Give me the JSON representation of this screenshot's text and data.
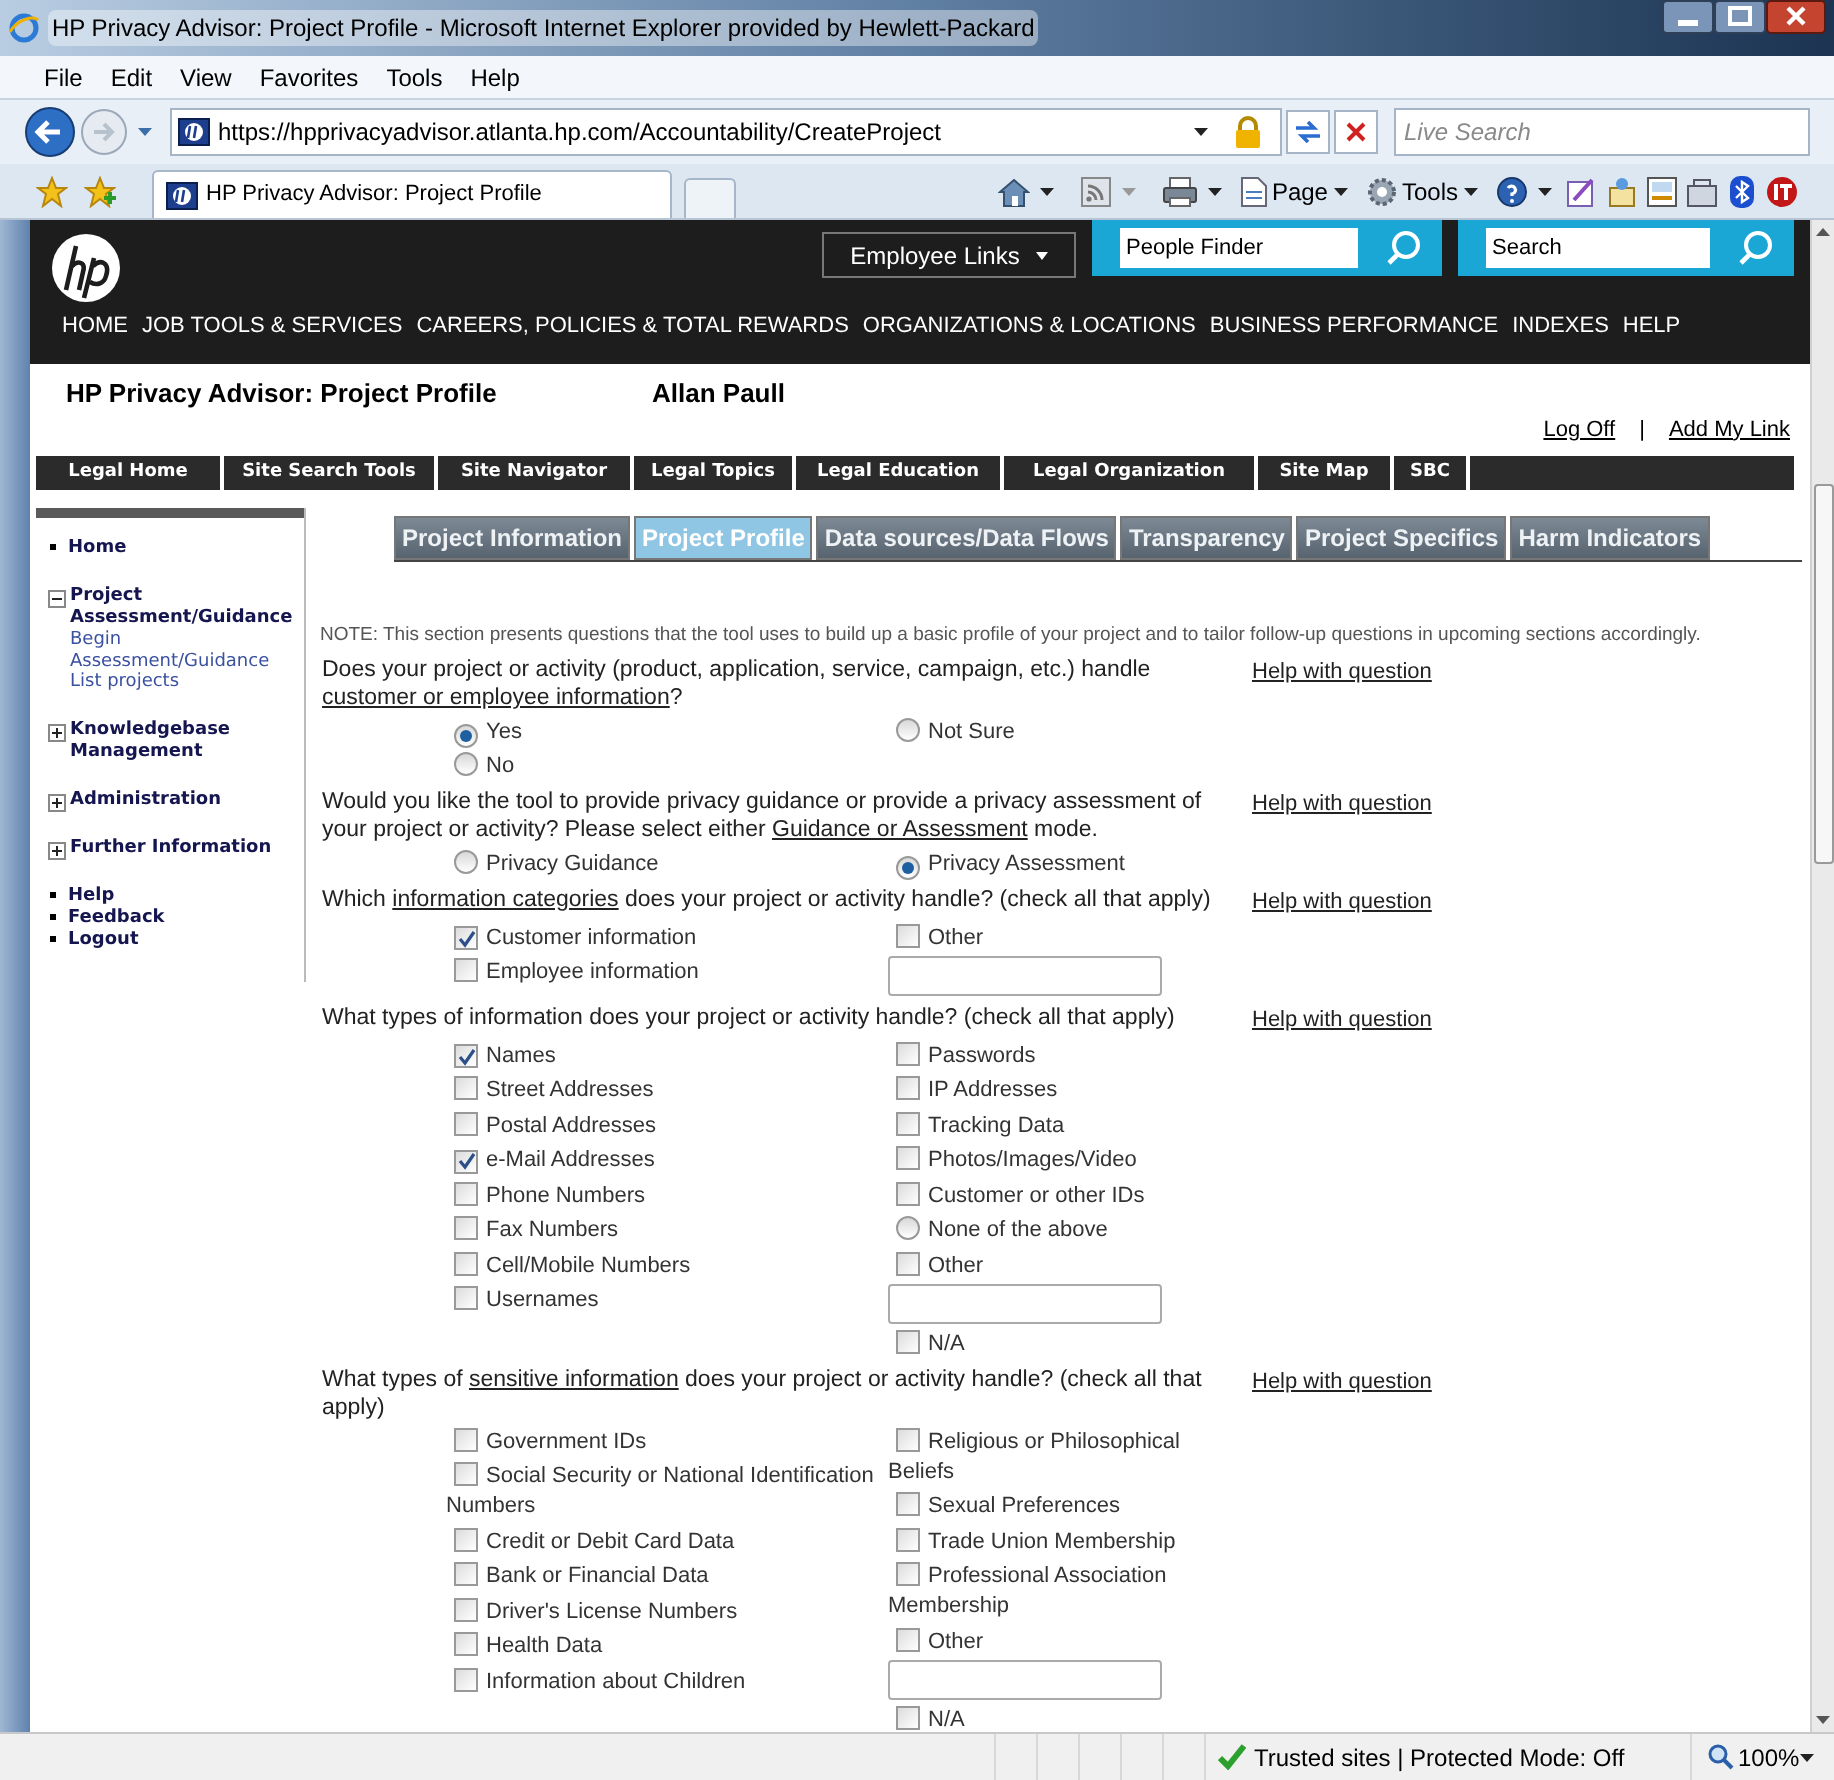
{
  "window": {
    "title": "HP Privacy Advisor: Project Profile - Microsoft Internet Explorer provided by Hewlett-Packard"
  },
  "menu": [
    "File",
    "Edit",
    "View",
    "Favorites",
    "Tools",
    "Help"
  ],
  "address_bar": {
    "url": "https://hpprivacyadvisor.atlanta.hp.com/Accountability/CreateProject",
    "search_placeholder": "Live Search"
  },
  "browser_tab": {
    "title": "HP Privacy Advisor: Project Profile"
  },
  "command_bar": [
    {
      "label": "Page"
    },
    {
      "label": "Tools"
    }
  ],
  "header": {
    "employee_links": "Employee Links",
    "people_finder": "People Finder",
    "search": "Search"
  },
  "top_nav": [
    "HOME",
    "JOB TOOLS & SERVICES",
    "CAREERS, POLICIES & TOTAL REWARDS",
    "ORGANIZATIONS & LOCATIONS",
    "BUSINESS PERFORMANCE",
    "INDEXES",
    "HELP"
  ],
  "page_title": "HP Privacy Advisor: Project Profile",
  "user": "Allan Paull",
  "user_links": [
    {
      "kind": "link",
      "text": "Log Off"
    },
    {
      "kind": "separator",
      "text": "|"
    },
    {
      "kind": "link",
      "text": "Add My Link"
    }
  ],
  "legal_nav": [
    "Legal Home",
    "Site Search Tools",
    "Site Navigator",
    "Legal Topics",
    "Legal Education",
    "Legal Organization",
    "Site Map",
    "SBC"
  ],
  "sidebar": {
    "groups": [
      [
        {
          "kind": "bullet",
          "label": "Home"
        }
      ],
      [
        {
          "kind": "tree",
          "label": "Project Assessment/Guidance",
          "expanded": true,
          "children": [
            {
              "label": "Begin Assessment/Guidance"
            },
            {
              "label": "List projects"
            }
          ]
        }
      ],
      [
        {
          "kind": "tree",
          "label": "Knowledgebase Management",
          "expanded": false
        }
      ],
      [
        {
          "kind": "tree",
          "label": "Administration",
          "expanded": false
        }
      ],
      [
        {
          "kind": "tree",
          "label": "Further Information",
          "expanded": false
        }
      ],
      [
        {
          "kind": "bullet",
          "label": "Help"
        },
        {
          "kind": "bullet",
          "label": "Feedback"
        },
        {
          "kind": "bullet",
          "label": "Logout"
        }
      ]
    ]
  },
  "tabs": [
    {
      "label": "Project Information",
      "selected": false
    },
    {
      "label": "Project Profile",
      "selected": true
    },
    {
      "label": "Data sources/Data Flows",
      "selected": false
    },
    {
      "label": "Transparency",
      "selected": false
    },
    {
      "label": "Project Specifics",
      "selected": false
    },
    {
      "label": "Harm Indicators",
      "selected": false
    }
  ],
  "note": "NOTE: This section presents questions that the tool uses to build up a basic profile of your project and to tailor follow-up questions in upcoming sections accordingly.",
  "questions": [
    {
      "parts": [
        {
          "kind": "plain",
          "text": "Does your project or activity (product, application, service, campaign, etc.) handle "
        },
        {
          "kind": "link",
          "text": "customer or employee information"
        },
        {
          "kind": "plain",
          "text": "?"
        }
      ],
      "help": "Help with question",
      "columns": [
        [
          {
            "kind": "radio",
            "label": "Yes",
            "checked": true
          },
          {
            "kind": "radio",
            "label": "No",
            "checked": false
          }
        ],
        [
          {
            "kind": "radio",
            "label": "Not Sure",
            "checked": false
          }
        ]
      ]
    },
    {
      "parts": [
        {
          "kind": "plain",
          "text": "Would you like the tool to provide privacy guidance or provide a privacy assessment of your project or activity? Please select either "
        },
        {
          "kind": "link",
          "text": "Guidance or Assessment"
        },
        {
          "kind": "plain",
          "text": " mode."
        }
      ],
      "help": "Help with question",
      "columns": [
        [
          {
            "kind": "radio",
            "label": "Privacy Guidance",
            "checked": false
          }
        ],
        [
          {
            "kind": "radio",
            "label": "Privacy Assessment",
            "checked": true
          }
        ]
      ]
    },
    {
      "parts": [
        {
          "kind": "plain",
          "text": "Which "
        },
        {
          "kind": "link",
          "text": "information categories"
        },
        {
          "kind": "plain",
          "text": " does your project or activity handle? (check all that apply)"
        }
      ],
      "help": "Help with question",
      "columns": [
        [
          {
            "kind": "checkbox",
            "label": "Customer information",
            "checked": true
          },
          {
            "kind": "checkbox",
            "label": "Employee information",
            "checked": false
          }
        ],
        [
          {
            "kind": "checkbox",
            "label": "Other",
            "checked": false
          },
          {
            "kind": "field"
          }
        ]
      ]
    },
    {
      "parts": [
        {
          "kind": "plain",
          "text": "What types of information does your project or activity handle? (check all that apply)"
        }
      ],
      "help": "Help with question",
      "columns": [
        [
          {
            "kind": "checkbox",
            "label": "Names",
            "checked": true
          },
          {
            "kind": "checkbox",
            "label": "Street Addresses",
            "checked": false
          },
          {
            "kind": "checkbox",
            "label": "Postal Addresses",
            "checked": false
          },
          {
            "kind": "checkbox",
            "label": "e-Mail Addresses",
            "checked": true
          },
          {
            "kind": "checkbox",
            "label": "Phone Numbers",
            "checked": false
          },
          {
            "kind": "checkbox",
            "label": "Fax Numbers",
            "checked": false
          },
          {
            "kind": "checkbox",
            "label": "Cell/Mobile Numbers",
            "checked": false
          },
          {
            "kind": "checkbox",
            "label": "Usernames",
            "checked": false
          }
        ],
        [
          {
            "kind": "checkbox",
            "label": "Passwords",
            "checked": false
          },
          {
            "kind": "checkbox",
            "label": "IP Addresses",
            "checked": false
          },
          {
            "kind": "checkbox",
            "label": "Tracking Data",
            "checked": false
          },
          {
            "kind": "checkbox",
            "label": "Photos/Images/Video",
            "checked": false
          },
          {
            "kind": "checkbox",
            "label": "Customer or other IDs",
            "checked": false
          },
          {
            "kind": "radio",
            "label": "None of the above",
            "checked": false
          },
          {
            "kind": "checkbox",
            "label": "Other",
            "checked": false
          },
          {
            "kind": "field"
          },
          {
            "kind": "checkbox",
            "label": "N/A",
            "checked": false
          }
        ]
      ]
    },
    {
      "parts": [
        {
          "kind": "plain",
          "text": "What types of "
        },
        {
          "kind": "link",
          "text": "sensitive information"
        },
        {
          "kind": "plain",
          "text": " does your project or activity handle? (check all that apply)"
        }
      ],
      "help": "Help with question",
      "columns": [
        [
          {
            "kind": "checkbox",
            "label": "Government IDs",
            "checked": false
          },
          {
            "kind": "checkbox",
            "label": "Social Security or National Identification Numbers",
            "checked": false
          },
          {
            "kind": "checkbox",
            "label": "Credit or Debit Card Data",
            "checked": false
          },
          {
            "kind": "checkbox",
            "label": "Bank or Financial Data",
            "checked": false
          },
          {
            "kind": "checkbox",
            "label": "Driver's License Numbers",
            "checked": false
          },
          {
            "kind": "checkbox",
            "label": "Health Data",
            "checked": false
          },
          {
            "kind": "checkbox",
            "label": "Information about Children",
            "checked": false
          }
        ],
        [
          {
            "kind": "checkbox",
            "label": "Religious or Philosophical Beliefs",
            "checked": false
          },
          {
            "kind": "checkbox",
            "label": "Sexual Preferences",
            "checked": false
          },
          {
            "kind": "checkbox",
            "label": "Trade Union Membership",
            "checked": false
          },
          {
            "kind": "checkbox",
            "label": "Professional Association Membership",
            "checked": false
          },
          {
            "kind": "checkbox",
            "label": "Other",
            "checked": false
          },
          {
            "kind": "field"
          },
          {
            "kind": "checkbox",
            "label": "N/A",
            "checked": false
          }
        ]
      ]
    }
  ],
  "status_bar": {
    "zone": "Trusted sites | Protected Mode: Off",
    "zoom": "100%"
  }
}
